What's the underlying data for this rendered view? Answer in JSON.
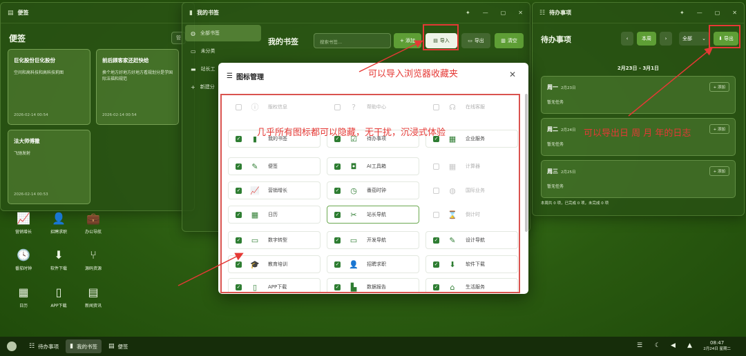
{
  "notes_window": {
    "title": "便签",
    "heading": "便签",
    "action_label": "管",
    "notes": [
      {
        "title": "巨化股份巨化股份",
        "body": "空间和高科技和高科技莉图",
        "date": "2026-02-14 00:54"
      },
      {
        "title": "前后顾客家还赶快给",
        "body": "换个地方好地方好地方看规划分是学国际法福和规范",
        "date": "2026-02-14 00:54"
      },
      {
        "title": "法大师傅撒",
        "body": "飞驰发射",
        "date": "2026-02-14 00:53"
      }
    ]
  },
  "desktop_icons": [
    {
      "label": "营销增长",
      "icon": "chart-icon",
      "glyph": "📈"
    },
    {
      "label": "招聘求职",
      "icon": "person-icon",
      "glyph": "👤"
    },
    {
      "label": "办公导航",
      "icon": "briefcase-icon",
      "glyph": "💼"
    },
    {
      "label": "番茄时钟",
      "icon": "clock-icon",
      "glyph": "🕓"
    },
    {
      "label": "软件下载",
      "icon": "download-icon",
      "glyph": "⬇"
    },
    {
      "label": "源码资源",
      "icon": "branch-icon",
      "glyph": "⑂"
    },
    {
      "label": "日历",
      "icon": "calendar-icon",
      "glyph": "▦"
    },
    {
      "label": "APP下载",
      "icon": "phone-icon",
      "glyph": "▯"
    },
    {
      "label": "新闻资讯",
      "icon": "news-icon",
      "glyph": "▤"
    }
  ],
  "bookmarks_window": {
    "title": "我的书签",
    "heading": "我的书签",
    "sidebar": [
      {
        "label": "全部书签",
        "icon": "globe-icon",
        "glyph": "◍",
        "active": true
      },
      {
        "label": "未分类",
        "icon": "inbox-icon",
        "glyph": "▭",
        "active": false
      },
      {
        "label": "站长工",
        "icon": "folder-icon",
        "glyph": "▬",
        "active": false
      },
      {
        "label": "新建分",
        "icon": "plus-icon",
        "glyph": "+",
        "active": false
      }
    ],
    "search_placeholder": "搜索书签...",
    "buttons": {
      "add": "+ 添加",
      "import": "导入",
      "export": "导出",
      "clear": "清空"
    }
  },
  "todo_window": {
    "title": "待办事项",
    "heading": "待办事项",
    "this_week": "本周",
    "filter": "全部",
    "export": "导出",
    "week_range": "2月23日 - 3月1日",
    "days": [
      {
        "name": "周一",
        "date": "2月23日",
        "task": "暂无任务",
        "add": "+ 添加"
      },
      {
        "name": "周二",
        "date": "2月24日",
        "task": "暂无任务",
        "add": "+ 添加"
      },
      {
        "name": "周三",
        "date": "2月25日",
        "task": "暂无任务",
        "add": "+ 添加"
      }
    ],
    "summary": "本周共 0 项，已完成 0 项，未完成 0 项"
  },
  "icon_manager": {
    "title": "图标管理",
    "items": [
      {
        "label": "版权信息",
        "icon": "info-icon",
        "glyph": "ⓘ",
        "checked": false
      },
      {
        "label": "帮助中心",
        "icon": "help-icon",
        "glyph": "?",
        "checked": false
      },
      {
        "label": "在线客服",
        "icon": "headset-icon",
        "glyph": "☊",
        "checked": false
      },
      {
        "label": "我的书签",
        "icon": "bookmark-icon",
        "glyph": "▮",
        "checked": true
      },
      {
        "label": "待办事项",
        "icon": "checklist-icon",
        "glyph": "☑",
        "checked": true
      },
      {
        "label": "企业服务",
        "icon": "building-icon",
        "glyph": "▦",
        "checked": true
      },
      {
        "label": "便签",
        "icon": "note-icon",
        "glyph": "✎",
        "checked": true
      },
      {
        "label": "AI工具箱",
        "icon": "robot-icon",
        "glyph": "◘",
        "checked": true
      },
      {
        "label": "计算器",
        "icon": "calculator-icon",
        "glyph": "▦",
        "checked": false
      },
      {
        "label": "营销增长",
        "icon": "chart-icon",
        "glyph": "📈",
        "checked": true
      },
      {
        "label": "番茄时钟",
        "icon": "clock-icon",
        "glyph": "◷",
        "checked": true
      },
      {
        "label": "国际业务",
        "icon": "globe-icon",
        "glyph": "◍",
        "checked": false
      },
      {
        "label": "日历",
        "icon": "calendar-icon",
        "glyph": "▦",
        "checked": true
      },
      {
        "label": "站长导航",
        "icon": "tools-icon",
        "glyph": "✂",
        "checked": true
      },
      {
        "label": "倒计时",
        "icon": "hourglass-icon",
        "glyph": "⌛",
        "checked": false
      },
      {
        "label": "数字转型",
        "icon": "card-icon",
        "glyph": "▭",
        "checked": true
      },
      {
        "label": "开发导航",
        "icon": "code-icon",
        "glyph": "▭",
        "checked": true
      },
      {
        "label": "设计导航",
        "icon": "brush-icon",
        "glyph": "✎",
        "checked": true
      },
      {
        "label": "教育培训",
        "icon": "graduation-icon",
        "glyph": "🎓",
        "checked": true
      },
      {
        "label": "招聘求职",
        "icon": "person-icon",
        "glyph": "👤",
        "checked": true
      },
      {
        "label": "软件下载",
        "icon": "download-icon",
        "glyph": "⬇",
        "checked": true
      },
      {
        "label": "APP下载",
        "icon": "phone-icon",
        "glyph": "▯",
        "checked": true
      },
      {
        "label": "数据报告",
        "icon": "report-icon",
        "glyph": "▙",
        "checked": true
      },
      {
        "label": "生活服务",
        "icon": "home-icon",
        "glyph": "⌂",
        "checked": true
      }
    ]
  },
  "annotations": {
    "import_note": "可以导入浏览器收藏夹",
    "hide_note": "几乎所有图标都可以隐藏，无干扰，沉浸式体验",
    "export_note": "可以导出日 周 月 年的日志"
  },
  "taskbar": {
    "items": [
      {
        "label": "待办事项",
        "icon": "checklist-icon",
        "glyph": "☷",
        "active": false
      },
      {
        "label": "我的书签",
        "icon": "bookmark-icon",
        "glyph": "▮",
        "active": true
      },
      {
        "label": "便签",
        "icon": "note-icon",
        "glyph": "▤",
        "active": false
      }
    ],
    "time": "08:47",
    "date": "2月24日 星期二"
  },
  "colors": {
    "accent": "#5e9e35",
    "annotation": "#e53935",
    "check": "#2e7d32"
  }
}
